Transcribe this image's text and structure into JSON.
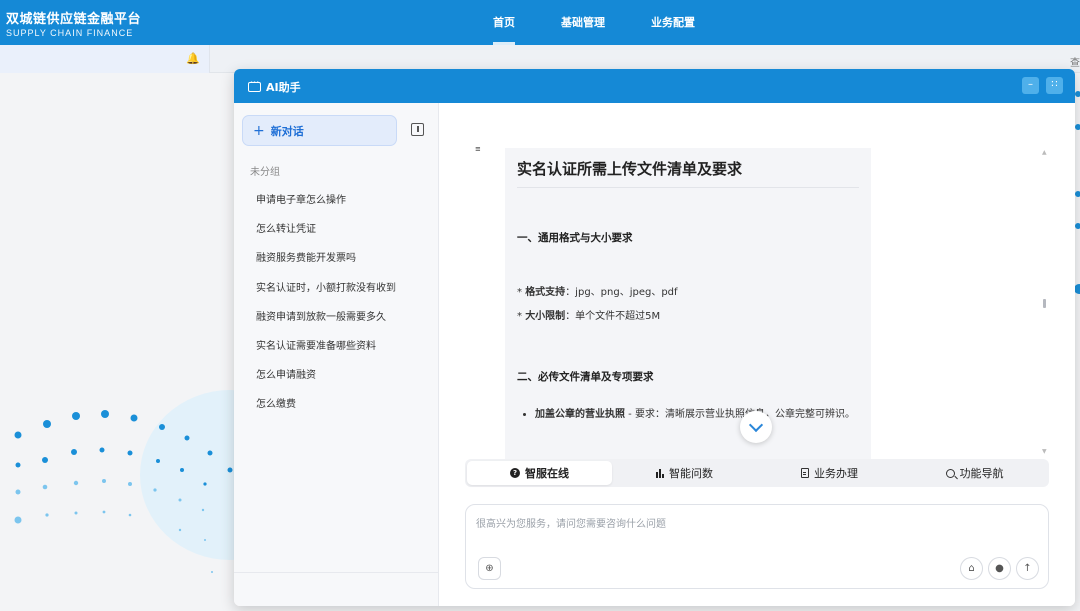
{
  "app": {
    "name_cn": "双城链供应链金融平台",
    "name_en": "SUPPLY CHAIN FINANCE",
    "nav": [
      {
        "label": "首页",
        "active": true
      },
      {
        "label": "基础管理",
        "active": false
      },
      {
        "label": "业务配置",
        "active": false
      }
    ],
    "partial_right_text": "查",
    "accent_color": "#1589d6"
  },
  "assistant": {
    "title": "AI助手",
    "new_chat_label": "新对话",
    "group_label": "未分组",
    "history": [
      "申请电子章怎么操作",
      "怎么转让凭证",
      "融资服务费能开发票吗",
      "实名认证时，小额打款没有收到",
      "融资申请到放款一般需要多久",
      "实名认证需要准备哪些资料",
      "怎么申请融资",
      "怎么缴费"
    ],
    "message": {
      "title": "实名认证所需上传文件清单及要求",
      "section1": "一、通用格式与大小要求",
      "fmt_label": "格式支持",
      "fmt_value": "：jpg、png、jpeg、pdf",
      "size_label": "大小限制",
      "size_value": "：单个文件不超过5M",
      "section2": "二、必传文件清单及专项要求",
      "item1_label": "加盖公章的营业执照",
      "item1_text": " - 要求：清晰展示营业执照信息，公章完整可辨识。"
    },
    "tabs": [
      {
        "label": "智服在线",
        "icon": "question-circle-icon",
        "active": true
      },
      {
        "label": "智能问数",
        "icon": "bar-chart-icon",
        "active": false
      },
      {
        "label": "业务办理",
        "icon": "document-icon",
        "active": false
      },
      {
        "label": "功能导航",
        "icon": "search-icon",
        "active": false
      }
    ],
    "input_placeholder": "很高兴为您服务，请问您需要咨询什么问题",
    "input_value": ""
  }
}
